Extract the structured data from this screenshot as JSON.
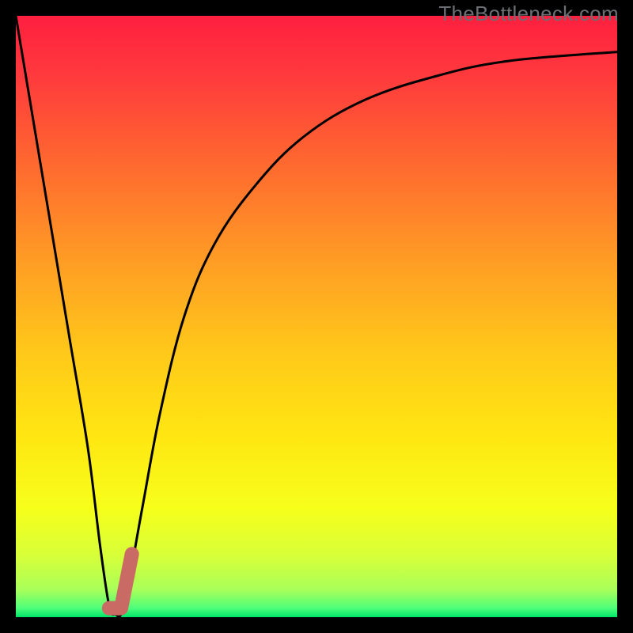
{
  "watermark": {
    "text": "TheBottleneck.com"
  },
  "gradient": {
    "stops": [
      {
        "offset": 0.0,
        "color": "#ff1f3f"
      },
      {
        "offset": 0.1,
        "color": "#ff3a3d"
      },
      {
        "offset": 0.25,
        "color": "#ff6a2f"
      },
      {
        "offset": 0.4,
        "color": "#ff9a25"
      },
      {
        "offset": 0.55,
        "color": "#ffc61a"
      },
      {
        "offset": 0.7,
        "color": "#ffe712"
      },
      {
        "offset": 0.82,
        "color": "#f6ff1a"
      },
      {
        "offset": 0.9,
        "color": "#d6ff3a"
      },
      {
        "offset": 0.955,
        "color": "#a8ff5a"
      },
      {
        "offset": 0.985,
        "color": "#4dff7a"
      },
      {
        "offset": 1.0,
        "color": "#00e56a"
      }
    ]
  },
  "chart_data": {
    "type": "line",
    "title": "",
    "xlabel": "",
    "ylabel": "",
    "xlim": [
      0,
      100
    ],
    "ylim": [
      0,
      100
    ],
    "series": [
      {
        "name": "bottleneck-curve",
        "points": [
          {
            "x": 0,
            "y": 100
          },
          {
            "x": 3,
            "y": 82
          },
          {
            "x": 6,
            "y": 64
          },
          {
            "x": 9,
            "y": 46
          },
          {
            "x": 12,
            "y": 28
          },
          {
            "x": 14,
            "y": 12
          },
          {
            "x": 15.5,
            "y": 2
          },
          {
            "x": 16.5,
            "y": 0.5
          },
          {
            "x": 18,
            "y": 2
          },
          {
            "x": 21,
            "y": 18
          },
          {
            "x": 24,
            "y": 34
          },
          {
            "x": 28,
            "y": 50
          },
          {
            "x": 33,
            "y": 62
          },
          {
            "x": 40,
            "y": 72
          },
          {
            "x": 48,
            "y": 80
          },
          {
            "x": 58,
            "y": 86
          },
          {
            "x": 70,
            "y": 90
          },
          {
            "x": 82,
            "y": 92.5
          },
          {
            "x": 100,
            "y": 94
          }
        ]
      }
    ],
    "marker": {
      "name": "highlight-segment",
      "color": "#c96a65",
      "thickness_px": 18,
      "points": [
        {
          "x": 15.5,
          "y": 1.5
        },
        {
          "x": 17.5,
          "y": 1.5
        },
        {
          "x": 19.3,
          "y": 10.5
        }
      ]
    }
  }
}
